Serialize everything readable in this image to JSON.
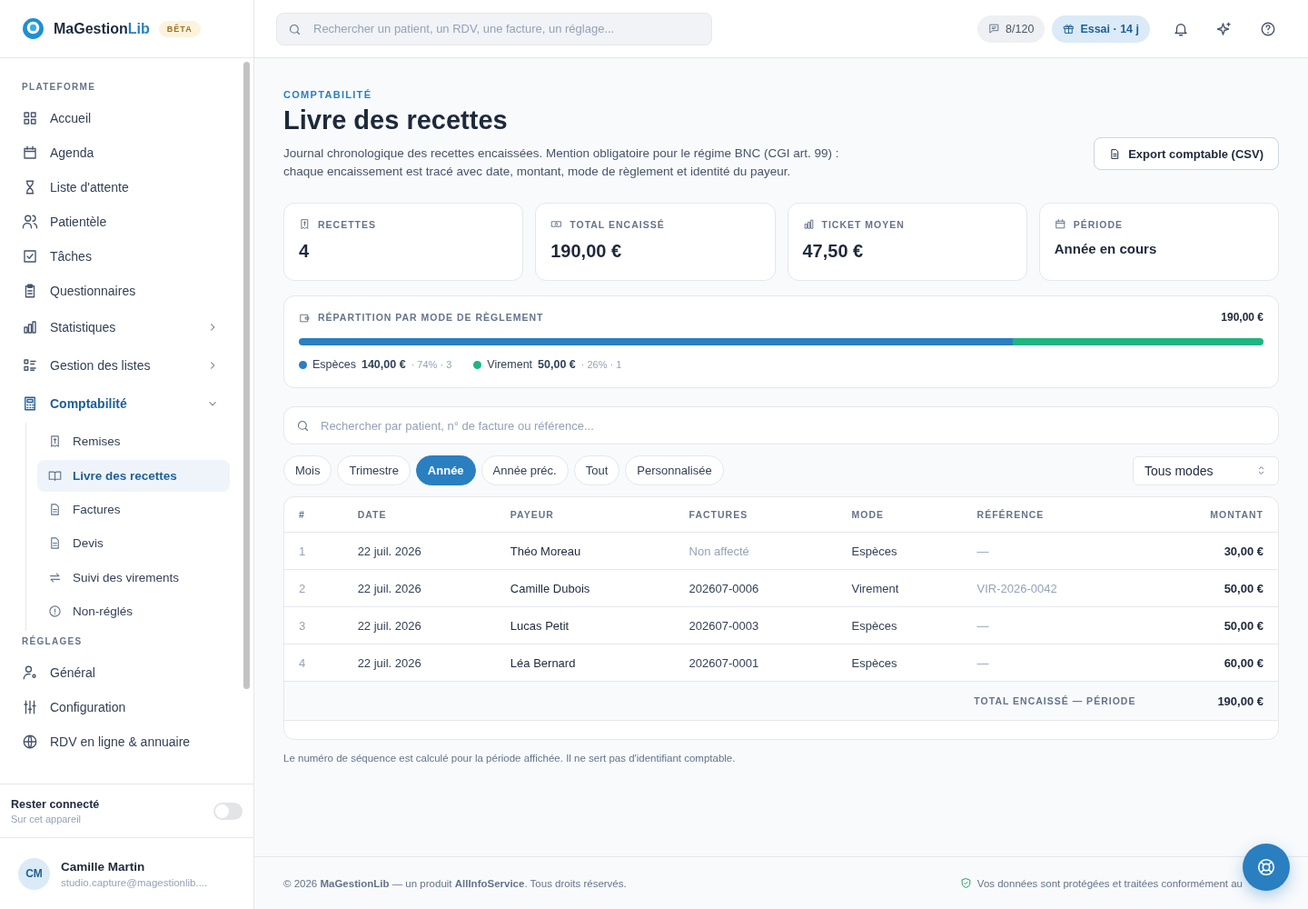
{
  "brand": {
    "name": "MaGestion",
    "name_accent": "Lib",
    "badge": "BÊTA"
  },
  "sidebar": {
    "sections": [
      {
        "title": "PLATEFORME",
        "items": [
          {
            "label": "Accueil",
            "selected": false
          },
          {
            "label": "Agenda",
            "selected": false
          },
          {
            "label": "Liste d'attente",
            "selected": false
          },
          {
            "label": "Patientèle",
            "selected": false
          },
          {
            "label": "Tâches",
            "selected": false
          },
          {
            "label": "Questionnaires",
            "selected": false
          },
          {
            "label": "Statistiques",
            "selected": false,
            "expanded": false
          },
          {
            "label": "Gestion des listes",
            "selected": false,
            "expanded": false
          },
          {
            "label": "Comptabilité",
            "selected": true,
            "expanded": true,
            "children": [
              {
                "label": "Remises",
                "selected": false
              },
              {
                "label": "Livre des recettes",
                "selected": true
              },
              {
                "label": "Factures",
                "selected": false
              },
              {
                "label": "Devis",
                "selected": false
              },
              {
                "label": "Suivi des virements",
                "selected": false
              },
              {
                "label": "Non-réglés",
                "selected": false
              }
            ]
          }
        ]
      },
      {
        "title": "RÉGLAGES",
        "items": [
          {
            "label": "Général",
            "selected": false
          },
          {
            "label": "Configuration",
            "selected": false
          },
          {
            "label": "RDV en ligne & annuaire",
            "selected": false
          }
        ]
      }
    ],
    "stay_connected": {
      "label": "Rester connecté",
      "sublabel": "Sur cet appareil",
      "on": false
    },
    "user": {
      "initials": "CM",
      "name": "Camille Martin",
      "email": "studio.capture@magestionlib...."
    }
  },
  "topbar": {
    "search": {
      "placeholder": "Rechercher un patient, un RDV, une facture, un réglage..."
    },
    "sms": "8/120",
    "trial": "Essai · 14 j"
  },
  "page": {
    "eyebrow": "COMPTABILITÉ",
    "title": "Livre des recettes",
    "description": "Journal chronologique des recettes encaissées. Mention obligatoire pour le régime BNC (CGI art. 99) : chaque encaissement est tracé avec date, montant, mode de règlement et identité du payeur.",
    "export_button": "Export comptable (CSV)"
  },
  "stats": [
    {
      "label": "RECETTES",
      "value": "4",
      "kind": "big"
    },
    {
      "label": "TOTAL ENCAISSÉ",
      "value": "190,00 €",
      "kind": "big"
    },
    {
      "label": "TICKET MOYEN",
      "value": "47,50 €",
      "kind": "big"
    },
    {
      "label": "PÉRIODE",
      "value": "Année en cours",
      "kind": "text"
    }
  ],
  "breakdown": {
    "title": "RÉPARTITION PAR MODE DE RÈGLEMENT",
    "total": "190,00 €",
    "modes": [
      {
        "label": "Espèces",
        "amount": "140,00 €",
        "meta": "· 74% · 3",
        "level": 0.74,
        "color": "#2a7fc0"
      },
      {
        "label": "Virement",
        "amount": "50,00 €",
        "meta": "· 26% · 1",
        "level": 0.26,
        "color": "#1db67f"
      }
    ]
  },
  "filter": {
    "search": {
      "placeholder": "Rechercher par patient, n° de facture ou référence..."
    },
    "periods": [
      {
        "label": "Mois",
        "selected": false
      },
      {
        "label": "Trimestre",
        "selected": false
      },
      {
        "label": "Année",
        "selected": true
      },
      {
        "label": "Année préc.",
        "selected": false
      },
      {
        "label": "Tout",
        "selected": false
      },
      {
        "label": "Personnalisée",
        "selected": false
      }
    ],
    "mode_select": "Tous modes"
  },
  "table": {
    "columns": [
      "#",
      "DATE",
      "PAYEUR",
      "FACTURES",
      "MODE",
      "RÉFÉRENCE",
      "MONTANT"
    ],
    "rows": [
      {
        "n": "1",
        "date": "22 juil. 2026",
        "payer": "Théo Moreau",
        "invoice": "Non affecté",
        "invoice_assigned": false,
        "mode": "Espèces",
        "reference": "—",
        "amount": "30,00 €"
      },
      {
        "n": "2",
        "date": "22 juil. 2026",
        "payer": "Camille Dubois",
        "invoice": "202607-0006",
        "invoice_assigned": true,
        "mode": "Virement",
        "reference": "VIR-2026-0042",
        "amount": "50,00 €"
      },
      {
        "n": "3",
        "date": "22 juil. 2026",
        "payer": "Lucas Petit",
        "invoice": "202607-0003",
        "invoice_assigned": true,
        "mode": "Espèces",
        "reference": "—",
        "amount": "50,00 €"
      },
      {
        "n": "4",
        "date": "22 juil. 2026",
        "payer": "Léa Bernard",
        "invoice": "202607-0001",
        "invoice_assigned": true,
        "mode": "Espèces",
        "reference": "—",
        "amount": "60,00 €"
      }
    ],
    "total_label": "TOTAL ENCAISSÉ — PÉRIODE",
    "total": "190,00 €"
  },
  "note": "Le numéro de séquence est calculé pour la période affichée. Il ne sert pas d'identifiant comptable.",
  "footer": {
    "copyright": "© 2026 **MaGestionLib** — un produit **AllInfoService**. Tous droits réservés.",
    "privacy": "Vos données sont protégées et traitées conformément au"
  }
}
